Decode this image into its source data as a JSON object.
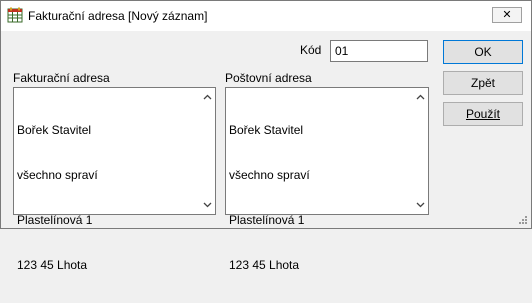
{
  "window": {
    "title": "Fakturační adresa  [Nový záznam]",
    "close_label": "✕"
  },
  "form": {
    "kod_label": "Kód",
    "kod_value": "01",
    "billing_label": "Fakturační adresa",
    "billing_lines": [
      "Bořek Stavitel",
      "všechno spraví",
      "Plastelínová 1",
      "123 45 Lhota"
    ],
    "postal_label": "Poštovní adresa",
    "postal_lines": [
      "Bořek Stavitel",
      "všechno spraví",
      "Plastelínová 1",
      "123 45 Lhota"
    ]
  },
  "buttons": {
    "ok": "OK",
    "zpet": "Zpět",
    "pouzit": "Použít"
  },
  "icons": {
    "app": "app-table-icon",
    "close": "close-icon"
  }
}
